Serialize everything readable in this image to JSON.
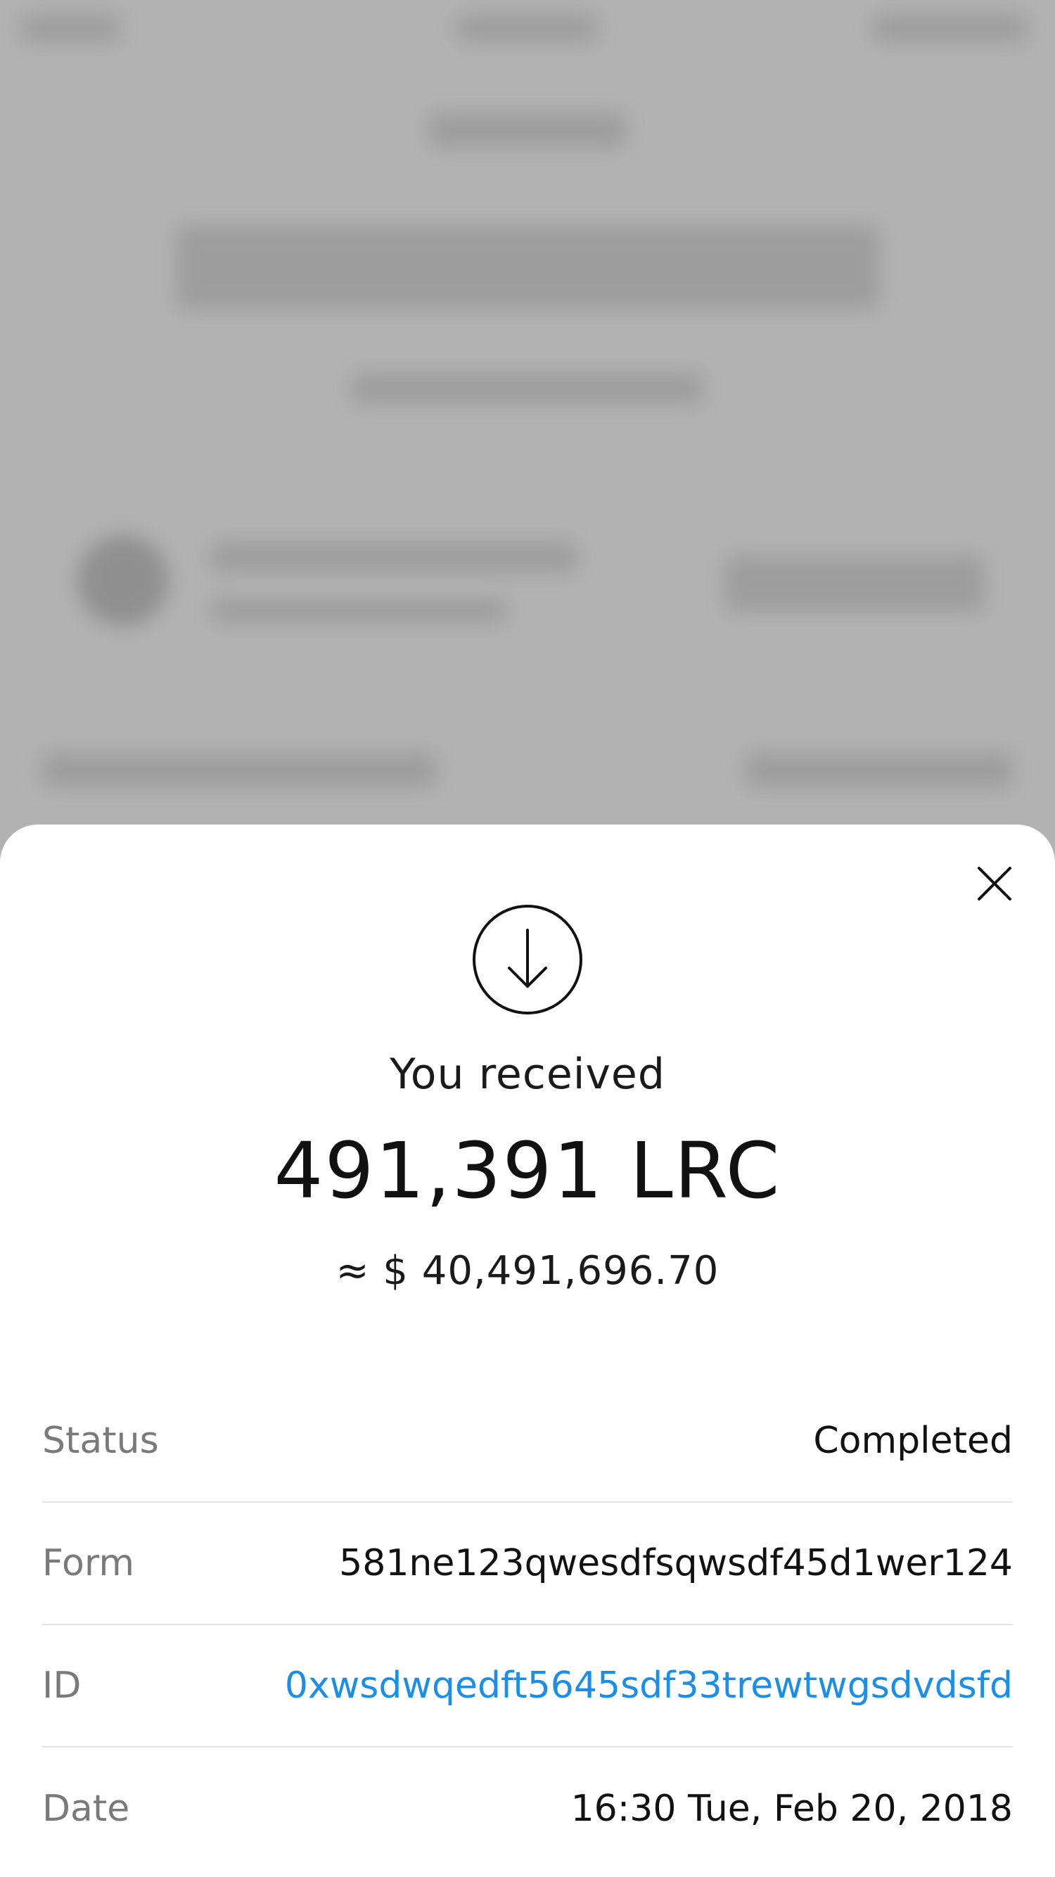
{
  "sheet": {
    "headline": "You received",
    "amount": "491,391 LRC",
    "fiat_value": "≈ $ 40,491,696.70",
    "icon": "arrow-down-circle-icon",
    "close_icon": "close-icon"
  },
  "details": [
    {
      "label": "Status",
      "value": "Completed"
    },
    {
      "label": "Form",
      "value": "581ne123qwesdfsqwsdf45d1wer124"
    },
    {
      "label": "ID",
      "value": "0xwsdwqedft5645sdf33trewtwgsdvdsfd",
      "is_link": true
    },
    {
      "label": "Date",
      "value": "16:30 Tue, Feb 20, 2018"
    }
  ],
  "colors": {
    "link": "#1b8fe8",
    "label": "#7a7a7a",
    "text": "#111111",
    "overlay": "#b3b3b3"
  }
}
